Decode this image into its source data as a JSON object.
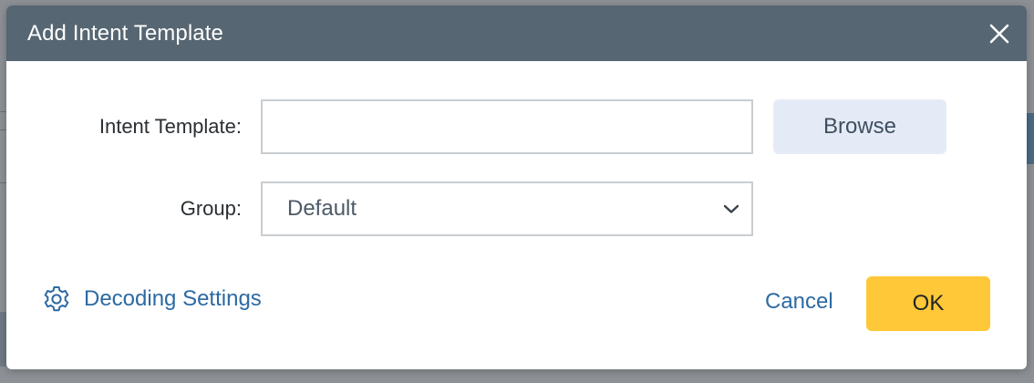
{
  "dialog": {
    "title": "Add Intent Template",
    "close_icon": "close-icon"
  },
  "form": {
    "intent_template": {
      "label": "Intent Template:",
      "value": "",
      "placeholder": ""
    },
    "browse_label": "Browse",
    "group": {
      "label": "Group:",
      "selected": "Default",
      "icon": "chevron-down-icon"
    }
  },
  "footer": {
    "decoding_settings_label": "Decoding Settings",
    "decoding_icon": "gear-icon",
    "cancel_label": "Cancel",
    "ok_label": "OK"
  },
  "colors": {
    "header_bg": "#566672",
    "link": "#2c6aa3",
    "ok_button": "#ffc838",
    "browse_button": "#e5ebf6"
  }
}
